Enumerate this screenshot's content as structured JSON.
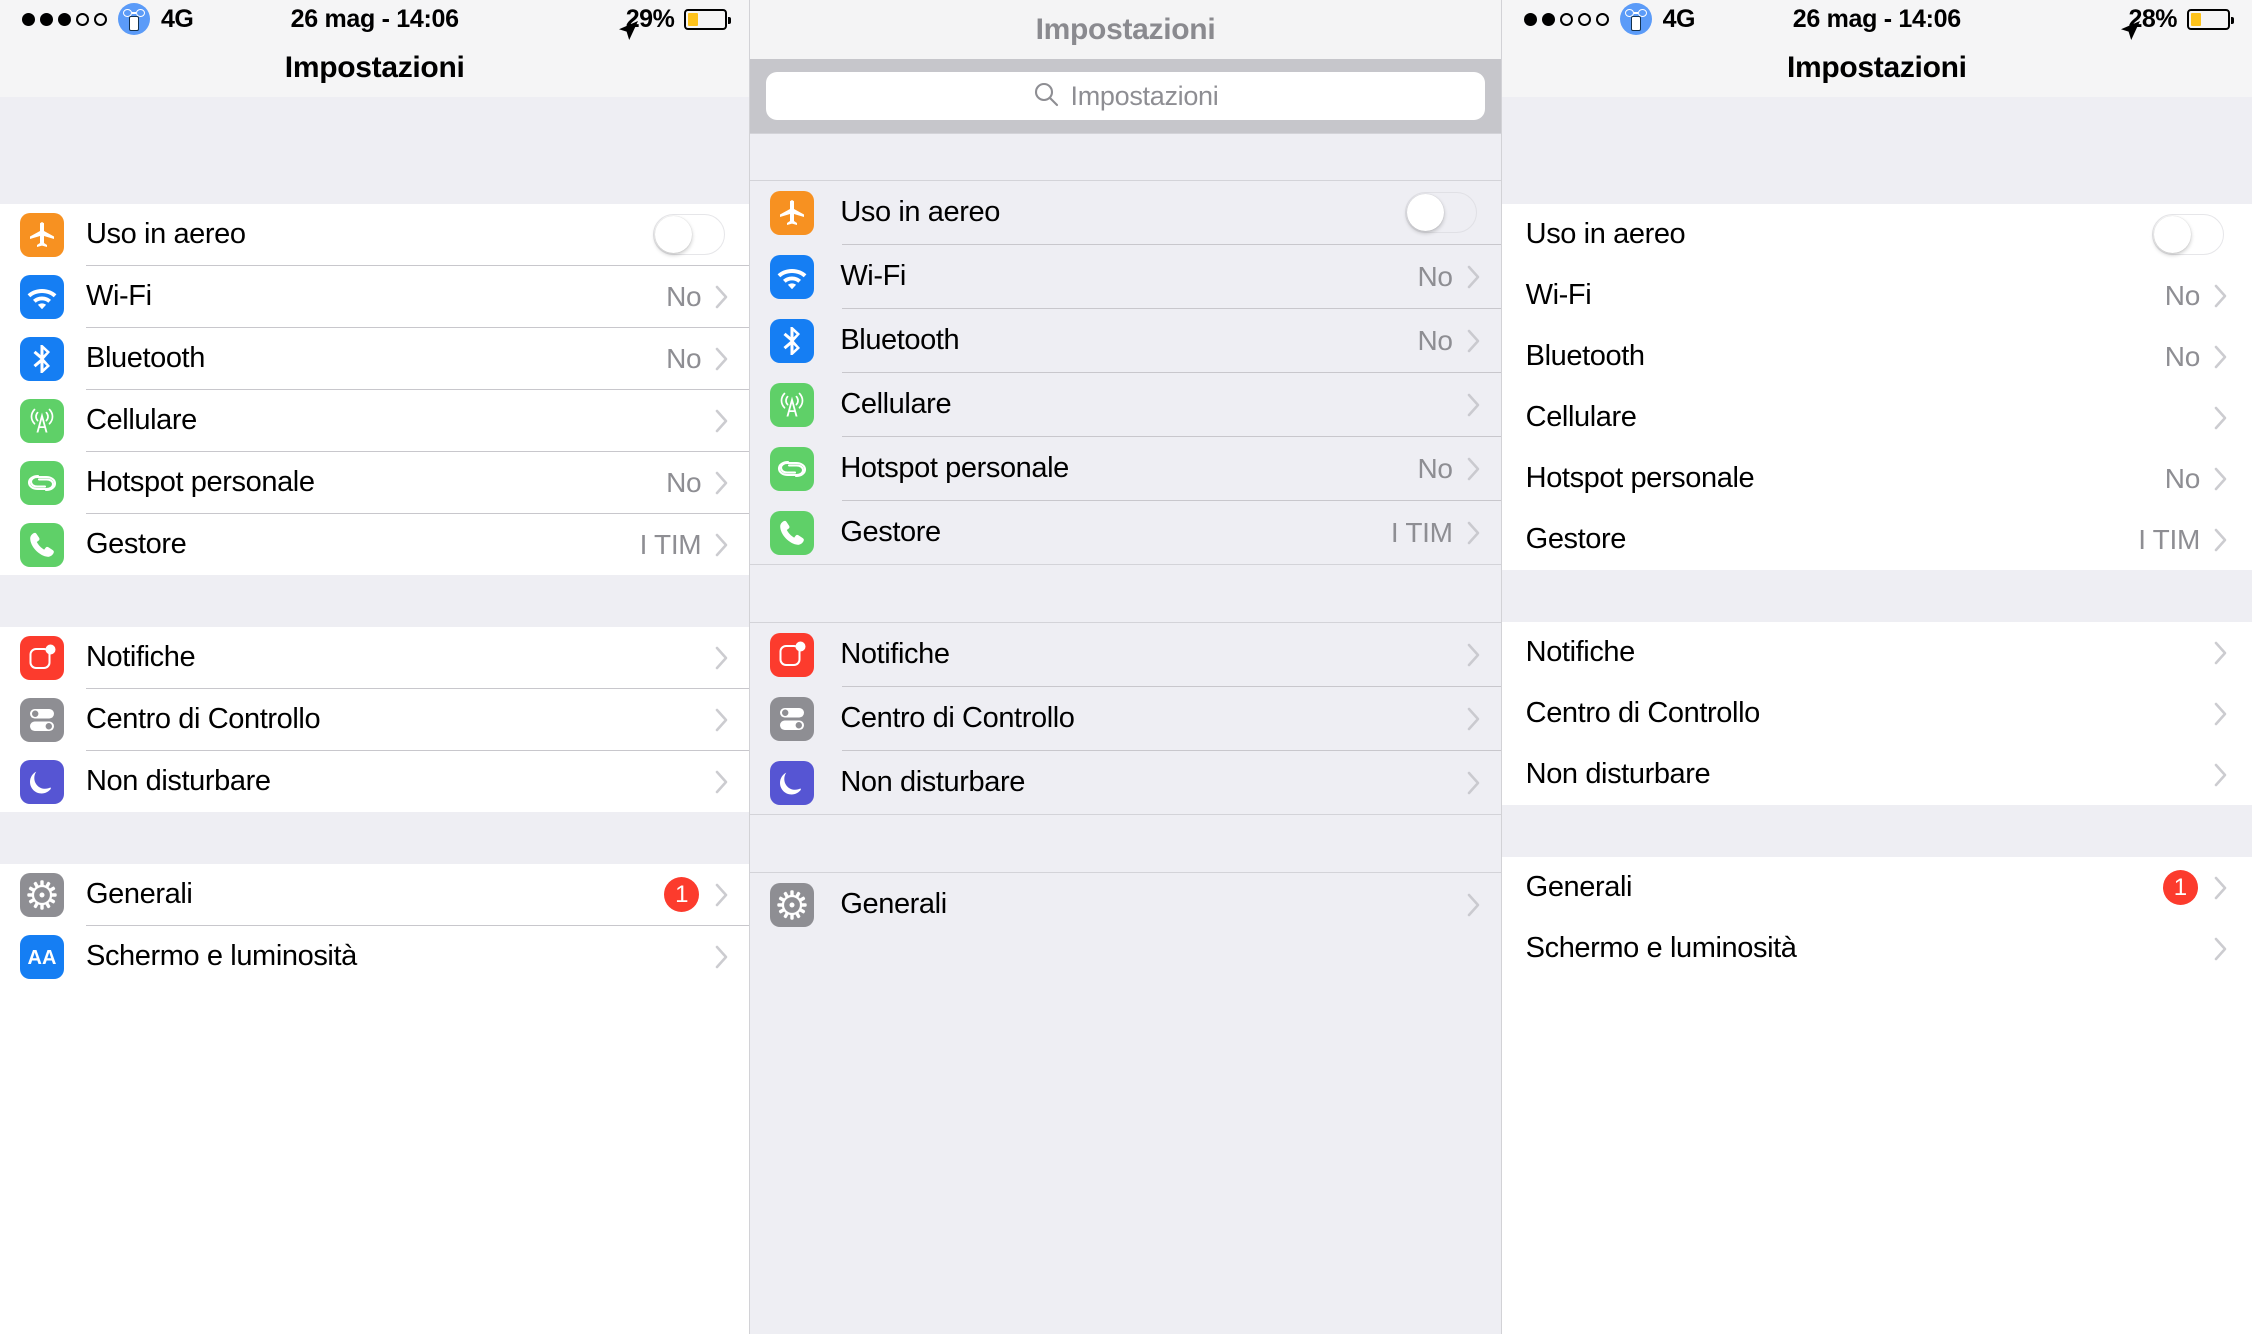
{
  "panels": [
    {
      "id": "panel-left",
      "statusbar": {
        "signal_dots_filled": 3,
        "signal_dots_total": 5,
        "carrier_icon": "carrier-glasses-icon",
        "network": "4G",
        "datetime": "26 mag - 14:06",
        "location_icon": "location-arrow-icon",
        "battery_percent": "29%",
        "battery_fill_ratio": 0.29,
        "battery_color": "#fdc21b"
      },
      "navbar": {
        "title": "Impostazioni",
        "title_color": "#000000"
      },
      "has_search": false,
      "has_icons": true,
      "top_spacer": true,
      "groups": [
        {
          "rows": [
            {
              "icon": "airplane-icon",
              "icon_class": "ic-airplane",
              "label": "Uso in aereo",
              "control": "toggle",
              "toggle_on": false
            },
            {
              "icon": "wifi-icon",
              "icon_class": "ic-wifi",
              "label": "Wi-Fi",
              "value": "No",
              "control": "chevron"
            },
            {
              "icon": "bluetooth-icon",
              "icon_class": "ic-bt",
              "label": "Bluetooth",
              "value": "No",
              "control": "chevron"
            },
            {
              "icon": "cellular-icon",
              "icon_class": "ic-cell",
              "label": "Cellulare",
              "value": "",
              "control": "chevron"
            },
            {
              "icon": "hotspot-icon",
              "icon_class": "ic-hotspot",
              "label": "Hotspot personale",
              "value": "No",
              "control": "chevron"
            },
            {
              "icon": "phone-icon",
              "icon_class": "ic-phone",
              "label": "Gestore",
              "value": "I TIM",
              "control": "chevron"
            }
          ]
        },
        {
          "rows": [
            {
              "icon": "notifications-icon",
              "icon_class": "ic-notif",
              "label": "Notifiche",
              "value": "",
              "control": "chevron"
            },
            {
              "icon": "control-center-icon",
              "icon_class": "ic-cc",
              "label": "Centro di Controllo",
              "value": "",
              "control": "chevron"
            },
            {
              "icon": "do-not-disturb-icon",
              "icon_class": "ic-dnd",
              "label": "Non disturbare",
              "value": "",
              "control": "chevron"
            }
          ]
        },
        {
          "rows": [
            {
              "icon": "gear-icon",
              "icon_class": "ic-gear",
              "label": "Generali",
              "badge": "1",
              "control": "chevron"
            },
            {
              "icon": "display-brightness-icon",
              "icon_class": "ic-display",
              "label": "Schermo e luminosità",
              "value": "",
              "control": "chevron"
            }
          ]
        }
      ]
    },
    {
      "id": "panel-center",
      "statusbar": null,
      "navbar": {
        "title": "Impostazioni",
        "title_color": "#8a8a8f"
      },
      "has_search": true,
      "search": {
        "placeholder": "Impostazioni",
        "icon": "search-icon",
        "value": ""
      },
      "has_icons": true,
      "top_spacer": true,
      "groups": [
        {
          "rows": [
            {
              "icon": "airplane-icon",
              "icon_class": "ic-airplane",
              "label": "Uso in aereo",
              "control": "toggle",
              "toggle_on": false
            },
            {
              "icon": "wifi-icon",
              "icon_class": "ic-wifi",
              "label": "Wi-Fi",
              "value": "No",
              "control": "chevron"
            },
            {
              "icon": "bluetooth-icon",
              "icon_class": "ic-bt",
              "label": "Bluetooth",
              "value": "No",
              "control": "chevron"
            },
            {
              "icon": "cellular-icon",
              "icon_class": "ic-cell",
              "label": "Cellulare",
              "value": "",
              "control": "chevron"
            },
            {
              "icon": "hotspot-icon",
              "icon_class": "ic-hotspot",
              "label": "Hotspot personale",
              "value": "No",
              "control": "chevron"
            },
            {
              "icon": "phone-icon",
              "icon_class": "ic-phone",
              "label": "Gestore",
              "value": "I TIM",
              "control": "chevron"
            }
          ]
        },
        {
          "rows": [
            {
              "icon": "notifications-icon",
              "icon_class": "ic-notif",
              "label": "Notifiche",
              "value": "",
              "control": "chevron"
            },
            {
              "icon": "control-center-icon",
              "icon_class": "ic-cc",
              "label": "Centro di Controllo",
              "value": "",
              "control": "chevron"
            },
            {
              "icon": "do-not-disturb-icon",
              "icon_class": "ic-dnd",
              "label": "Non disturbare",
              "value": "",
              "control": "chevron"
            }
          ]
        },
        {
          "rows": [
            {
              "icon": "gear-icon",
              "icon_class": "ic-gear",
              "label": "Generali",
              "value": "",
              "control": "chevron"
            }
          ]
        }
      ]
    },
    {
      "id": "panel-right",
      "statusbar": {
        "signal_dots_filled": 2,
        "signal_dots_total": 5,
        "carrier_icon": "carrier-glasses-icon",
        "network": "4G",
        "datetime": "26 mag - 14:06",
        "location_icon": "location-arrow-icon",
        "battery_percent": "28%",
        "battery_fill_ratio": 0.28,
        "battery_color": "#fdc21b"
      },
      "navbar": {
        "title": "Impostazioni",
        "title_color": "#000000"
      },
      "has_search": false,
      "has_icons": false,
      "top_spacer": true,
      "groups": [
        {
          "rows": [
            {
              "label": "Uso in aereo",
              "control": "toggle",
              "toggle_on": false
            },
            {
              "label": "Wi-Fi",
              "value": "No",
              "control": "chevron"
            },
            {
              "label": "Bluetooth",
              "value": "No",
              "control": "chevron"
            },
            {
              "label": "Cellulare",
              "value": "",
              "control": "chevron"
            },
            {
              "label": "Hotspot personale",
              "value": "No",
              "control": "chevron"
            },
            {
              "label": "Gestore",
              "value": "I TIM",
              "control": "chevron"
            }
          ]
        },
        {
          "rows": [
            {
              "label": "Notifiche",
              "value": "",
              "control": "chevron"
            },
            {
              "label": "Centro di Controllo",
              "value": "",
              "control": "chevron"
            },
            {
              "label": "Non disturbare",
              "value": "",
              "control": "chevron"
            }
          ]
        },
        {
          "rows": [
            {
              "label": "Generali",
              "badge": "1",
              "control": "chevron"
            },
            {
              "label": "Schermo e luminosità",
              "value": "",
              "control": "chevron"
            }
          ]
        }
      ]
    }
  ]
}
